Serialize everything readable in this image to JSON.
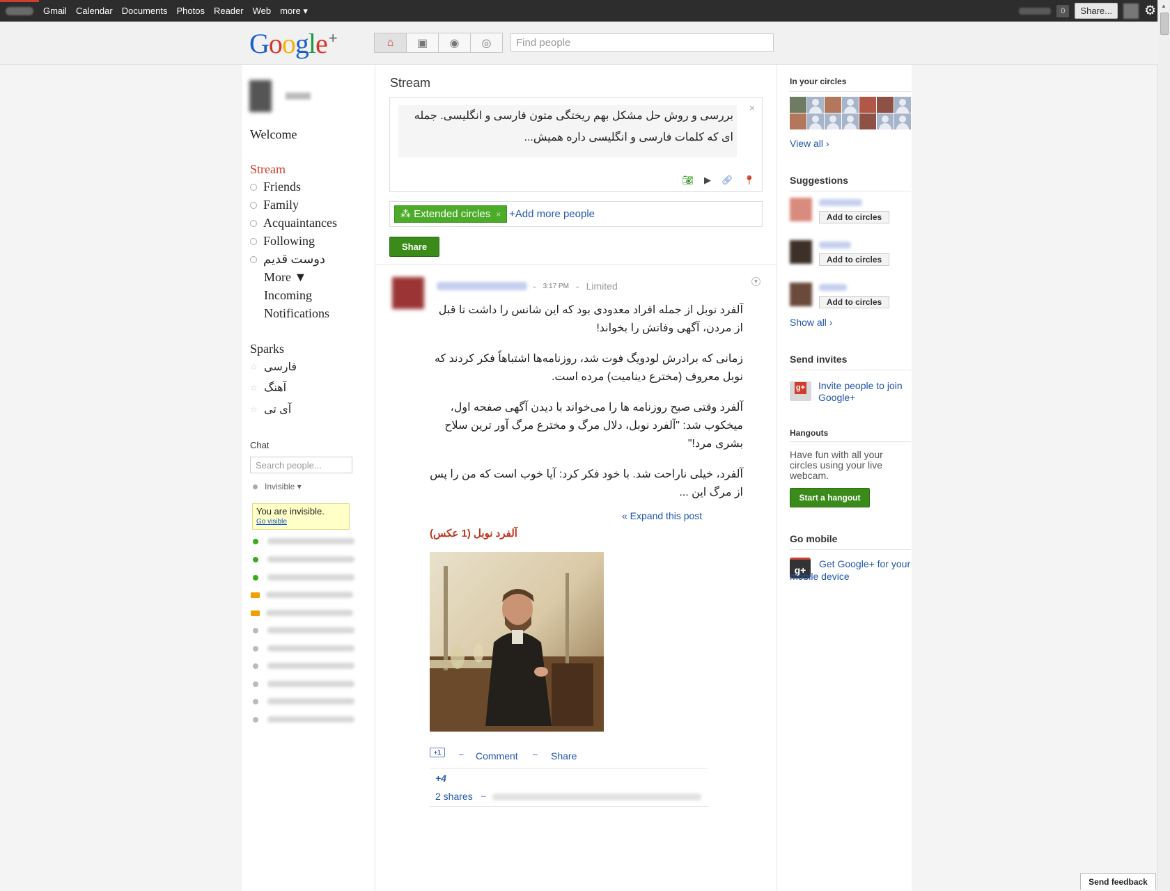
{
  "topbar": {
    "nav": [
      "Gmail",
      "Calendar",
      "Documents",
      "Photos",
      "Reader",
      "Web",
      "more ▾"
    ],
    "notif_count": "0",
    "share_label": "Share..."
  },
  "header": {
    "logo": "Google",
    "logo_plus": "+",
    "search_placeholder": "Find people"
  },
  "left": {
    "welcome": "Welcome",
    "stream": "Stream",
    "circles": [
      "Friends",
      "Family",
      "Acquaintances",
      "Following",
      "دوست قدیم"
    ],
    "more": "More ▼",
    "incoming": "Incoming",
    "notifications": "Notifications",
    "sparks_title": "Sparks",
    "sparks": [
      "فارسی",
      "آهنگ",
      "آی تی"
    ],
    "chat_title": "Chat",
    "chat_search_placeholder": "Search people...",
    "status": "Invisible ▾",
    "invisible_note": "You are invisible.",
    "go_visible": "Go visible"
  },
  "center": {
    "title": "Stream",
    "compose_text": "بررسی و روش حل مشکل بهم ریختگی متون فارسی و انگلیسی. جمله ای که کلمات فارسی و انگلیسی داره همیش...",
    "compose_close": "×",
    "chip_label": "Extended circles",
    "add_people": "+Add more people",
    "share_button": "Share",
    "post": {
      "dash": "-",
      "time": "3:17 PM",
      "visibility": "Limited",
      "paragraphs": [
        "آلفرد نوبل از جمله افراد معدودی بود که این شانس را داشت تا قبل از مردن، آگهی وفاتش را بخواند!",
        "زمانی که برادرش لودویگ فوت شد، روزنامه‌ها اشتباهاً فکر کردند که نوبل معروف (مخترع دینامیت) مرده است.",
        "آلفرد وقتی صبح روزنامه ها را می‌خواند با دیدن آگهی صفحه اول، میخکوب شد: \"آلفرد نوبل، دلال مرگ و مخترع مرگ آور ترین سلاح بشری مرد!\"",
        "آلفرد، خیلی ناراحت شد. با خود فکر کرد: آیا خوب است که من را پس از مرگ این ..."
      ],
      "expand": "« Expand this post",
      "album_title": "آلفرد نوبل (1 عکس)",
      "plus_one_label": "+1",
      "comment": "Comment",
      "share": "Share",
      "plus_count": "+4",
      "shares": "2 shares"
    }
  },
  "right": {
    "in_circles": "In your circles",
    "view_all": "View all ›",
    "suggestions_title": "Suggestions",
    "add_to_circles": "Add to circles",
    "show_all": "Show all ›",
    "send_invites": "Send invites",
    "invite_text": "Invite people to join Google+",
    "hangouts_title": "Hangouts",
    "hangouts_text": "Have fun with all your circles using your live webcam.",
    "hangout_button": "Start a hangout",
    "go_mobile": "Go mobile",
    "mobile_text": "Get Google+ for your mobile device"
  },
  "feedback": "Send feedback",
  "colors": {
    "accent_red": "#d03c2d",
    "button_green": "#3b8b1a",
    "link_blue": "#2255aa",
    "topbar": "#2d2d2d"
  }
}
